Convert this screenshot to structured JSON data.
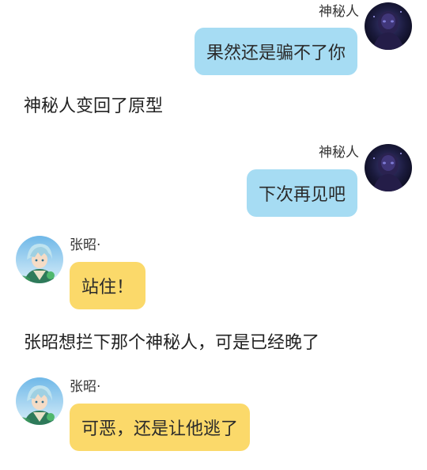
{
  "colors": {
    "player_bubble": "#a6dcf3",
    "npc_bubble": "#fbd96a",
    "background": "#ffffff"
  },
  "messages": [
    {
      "speaker": "神秘人",
      "side": "right",
      "avatar_icon": "mysterious-person-avatar-icon",
      "text": "果然还是骗不了你"
    },
    {
      "narration": "神秘人变回了原型"
    },
    {
      "speaker": "神秘人",
      "side": "right",
      "avatar_icon": "mysterious-person-avatar-icon",
      "text": "下次再见吧"
    },
    {
      "speaker": "张昭·",
      "side": "left",
      "avatar_icon": "zhang-zhao-avatar-icon",
      "text": "站住！"
    },
    {
      "narration": "张昭想拦下那个神秘人，可是已经晚了"
    },
    {
      "speaker": "张昭·",
      "side": "left",
      "avatar_icon": "zhang-zhao-avatar-icon",
      "text": "可恶，还是让他逃了"
    }
  ]
}
